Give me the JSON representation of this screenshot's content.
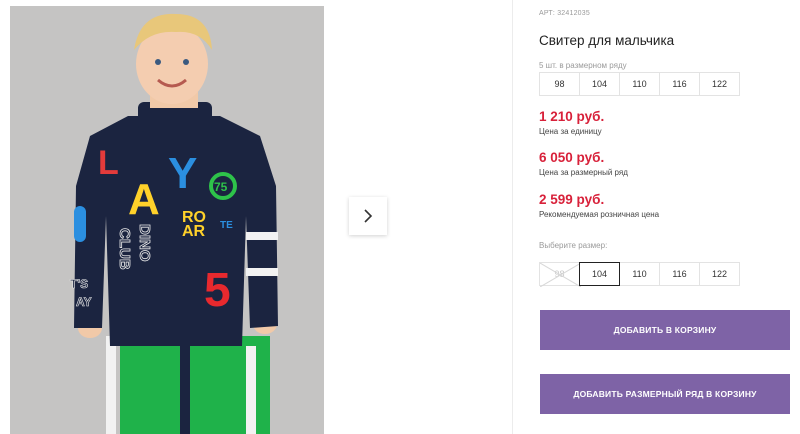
{
  "product": {
    "article_label": "АРТ:",
    "article_number": "32412035",
    "title": "Свитер для мальчика",
    "pack_label": "5 шт. в размерном ряду",
    "pack_sizes": [
      "98",
      "104",
      "110",
      "116",
      "122"
    ],
    "prices": [
      {
        "value": "1 210 руб.",
        "note": "Цена за единицу"
      },
      {
        "value": "6 050 руб.",
        "note": "Цена за размерный ряд"
      },
      {
        "value": "2 599 руб.",
        "note": "Рекомендуемая розничная цена"
      }
    ],
    "choose_size_label": "Выберите размер:",
    "choose_sizes": [
      {
        "label": "98",
        "state": "disabled"
      },
      {
        "label": "104",
        "state": "selected"
      },
      {
        "label": "110",
        "state": "available"
      },
      {
        "label": "116",
        "state": "available"
      },
      {
        "label": "122",
        "state": "available"
      }
    ],
    "add_to_cart": "ДОБАВИТЬ В КОРЗИНУ",
    "add_pack_to_cart": "ДОБАВИТЬ РАЗМЕРНЫЙ РЯД В КОРЗИНУ"
  },
  "gallery": {
    "next_icon": "chevron-right-icon",
    "sweater_letters": [
      "L",
      "A",
      "Y",
      "75",
      "RO",
      "AR",
      "TE",
      "DINO",
      "CLUB",
      "5",
      "T'S",
      "AY"
    ]
  },
  "colors": {
    "price": "#d8213a",
    "button": "#7e63a6",
    "sweater": "#1b2440",
    "pants": "#1fb24a"
  }
}
